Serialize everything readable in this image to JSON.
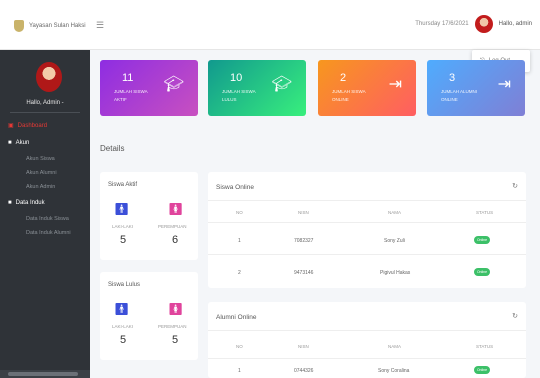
{
  "header": {
    "brand": "Yayasan Sulan Haksi",
    "menu_icon": "hamburger-icon",
    "date": "Thursday 17/6/2021",
    "user": "Hallo, admin",
    "logout": "Log Out"
  },
  "sidebar": {
    "hello": "Hallo, Admin -",
    "items": [
      {
        "label": "Dashboard",
        "color": "#e53935"
      },
      {
        "label": "Akun",
        "color": "#ffffff"
      },
      {
        "label": "Akun Siswa",
        "sub": true
      },
      {
        "label": "Akun Alumni",
        "sub": true
      },
      {
        "label": "Akun Admin",
        "sub": true
      },
      {
        "label": "Data Induk",
        "color": "#ffffff"
      },
      {
        "label": "Data Induk Siswa",
        "sub": true
      },
      {
        "label": "Data Induk Alumni",
        "sub": true
      }
    ]
  },
  "cards": [
    {
      "value": "11",
      "label": "JUMLAH SISWA AKTIF",
      "icon": "graduation-cap-icon",
      "color_from": "#8e2de2",
      "color_to": "#c850c0"
    },
    {
      "value": "10",
      "label": "JUMLAH SISWA LULUS",
      "icon": "graduation-cap-icon",
      "color_from": "#11998e",
      "color_to": "#38ef7d"
    },
    {
      "value": "2",
      "label": "JUMLAH SISWA ONLINE",
      "icon": "sign-in-icon",
      "color_from": "#f7971e",
      "color_to": "#ff5e62"
    },
    {
      "value": "3",
      "label": "JUMLAH ALUMNI ONLINE",
      "icon": "sign-in-icon",
      "color_from": "#4facfe",
      "color_to": "#7f7fd5"
    }
  ],
  "details_title": "Details",
  "siswa_aktif": {
    "title": "Siswa Aktif",
    "male_label": "LAKI-LAKI",
    "female_label": "PEREMPUAN",
    "male": "5",
    "female": "6"
  },
  "siswa_lulus": {
    "title": "Siswa Lulus",
    "male_label": "LAKI-LAKI",
    "female_label": "PEREMPUAN",
    "male": "5",
    "female": "5"
  },
  "siswa_online": {
    "title": "Siswa Online",
    "headers": [
      "NO",
      "NISN",
      "NAMA",
      "STATUS"
    ],
    "rows": [
      {
        "no": "1",
        "nisn": "7082327",
        "nama": "Sony Zuli",
        "status": "Online"
      },
      {
        "no": "2",
        "nisn": "9473146",
        "nama": "Pigivul Hakas",
        "status": "Online"
      }
    ]
  },
  "alumni_online": {
    "title": "Alumni Online",
    "headers": [
      "NO",
      "NISN",
      "NAMA",
      "STATUS"
    ],
    "rows": [
      {
        "no": "1",
        "nisn": "0744326",
        "nama": "Sony Coralina",
        "status": "Online"
      }
    ]
  },
  "colors": {
    "male": "#3b4fd8",
    "female": "#e0449c",
    "badge": "#3cc068",
    "sidebar": "#2f3338"
  }
}
